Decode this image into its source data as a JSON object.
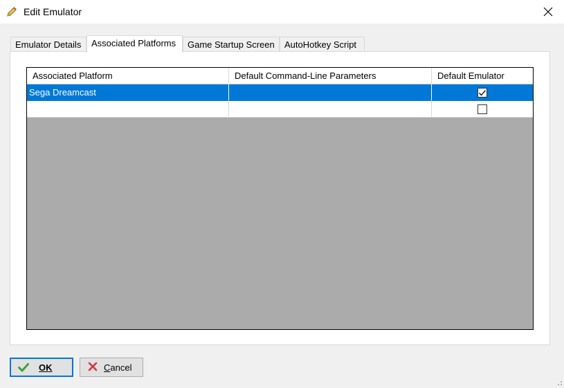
{
  "window": {
    "title": "Edit Emulator"
  },
  "tabs": [
    {
      "label": "Emulator Details",
      "active": false
    },
    {
      "label": "Associated Platforms",
      "active": true
    },
    {
      "label": "Game Startup Screen",
      "active": false
    },
    {
      "label": "AutoHotkey Script",
      "active": false
    }
  ],
  "grid": {
    "columns": [
      "Associated Platform",
      "Default Command-Line Parameters",
      "Default Emulator"
    ],
    "rows": [
      {
        "platform": "Sega Dreamcast",
        "params": "",
        "default": true,
        "selected": true
      },
      {
        "platform": "",
        "params": "",
        "default": false,
        "selected": false
      }
    ]
  },
  "buttons": {
    "ok_label": "OK",
    "cancel_first": "C",
    "cancel_rest": "ancel"
  },
  "colors": {
    "selection": "#0078d7",
    "grid_background": "#ababab",
    "ok_icon": "#3ca03c",
    "cancel_icon": "#d8343c"
  },
  "icons": {
    "title": "pencil-icon",
    "close": "close-icon",
    "ok": "checkmark-icon",
    "cancel": "x-icon"
  }
}
